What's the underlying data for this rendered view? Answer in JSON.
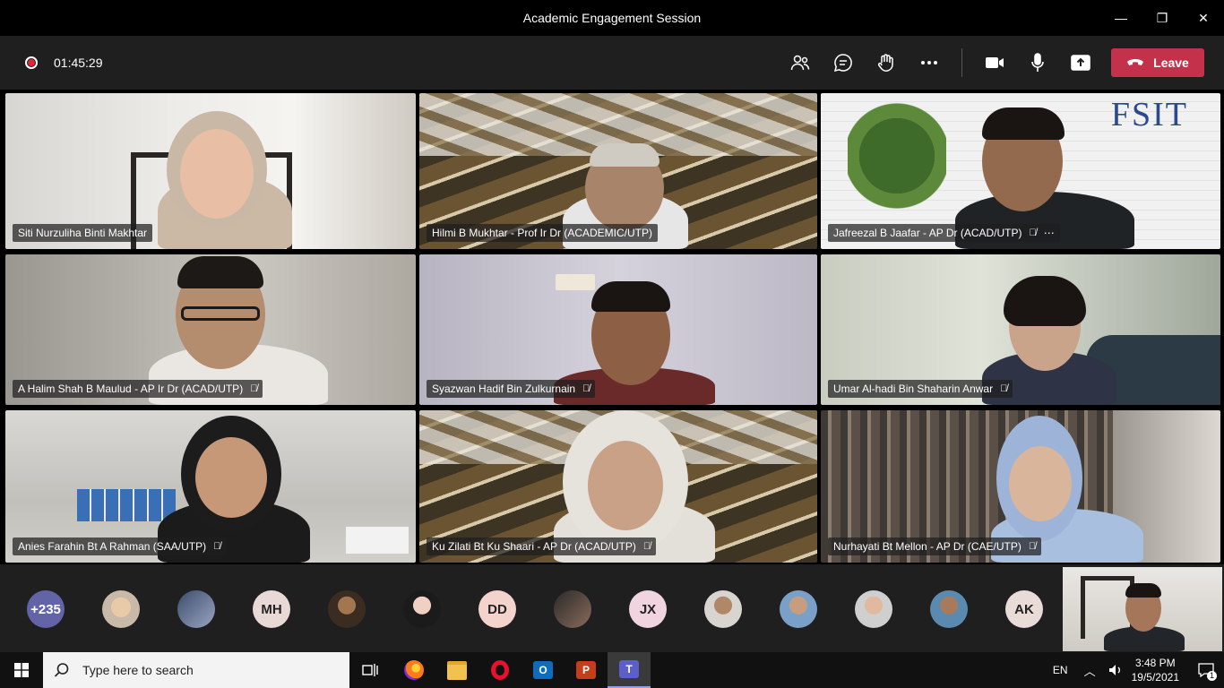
{
  "window": {
    "title": "Academic Engagement Session",
    "controls": {
      "minimize": "—",
      "maximize": "❐",
      "close": "✕"
    }
  },
  "toolbar": {
    "timer": "01:45:29",
    "leave_label": "Leave",
    "icons": [
      "people-icon",
      "chat-icon",
      "raise-hand-icon",
      "more-icon",
      "camera-icon",
      "mic-icon",
      "share-icon"
    ]
  },
  "participants": [
    {
      "name": "Siti Nurzuliha Binti Makhtar",
      "muted": false
    },
    {
      "name": "Hilmi B Mukhtar - Prof Ir Dr (ACADEMIC/UTP)",
      "muted": false
    },
    {
      "name": "Jafreezal B Jaafar - AP Dr (ACAD/UTP)",
      "muted": true,
      "more": "⋯"
    },
    {
      "name": "A Halim Shah B Maulud - AP Ir Dr (ACAD/UTP)",
      "muted": true
    },
    {
      "name": "Syazwan Hadif Bin Zulkurnain",
      "muted": true
    },
    {
      "name": "Umar Al-hadi Bin Shaharin Anwar",
      "muted": true
    },
    {
      "name": "Anies Farahin Bt A Rahman (SAA/UTP)",
      "muted": true
    },
    {
      "name": "Ku Zilati Bt Ku Shaari - AP Dr (ACAD/UTP)",
      "muted": true
    },
    {
      "name": "Nurhayati Bt Mellon - AP Dr (CAE/UTP)",
      "muted": true
    }
  ],
  "wall_logo": "FSIT",
  "roster": {
    "overflow": "+235",
    "initials": [
      "MH",
      "DD",
      "JX",
      "AK"
    ]
  },
  "taskbar": {
    "search_placeholder": "Type here to search",
    "language": "EN",
    "time": "3:48 PM",
    "date": "19/5/2021",
    "notifications": "1"
  },
  "colors": {
    "leave": "#c4314b",
    "toolbar": "#1f1f1f",
    "overflow_avatar": "#6264a7",
    "initials_avatar": "#e8d9d6"
  }
}
